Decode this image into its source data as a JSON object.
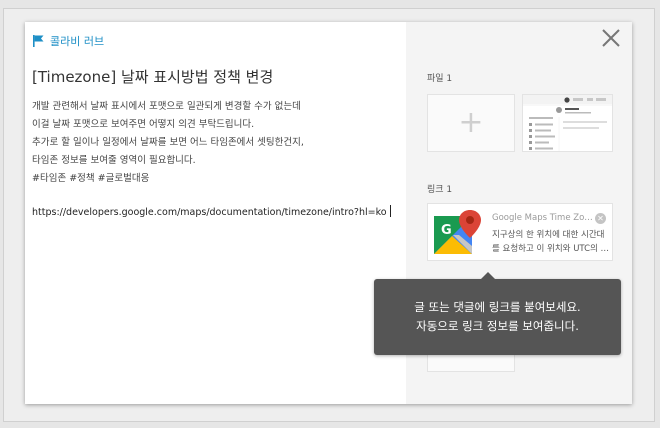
{
  "brand": {
    "label": "콜라비 러브",
    "icon": "flag-icon",
    "color": "#1e8fc6"
  },
  "post": {
    "title": "[Timezone] 날짜 표시방법 정책 변경",
    "lines": [
      "개발 관련해서 날짜 표시에서 포맷으로 일관되게 변경할 수가 없는데",
      "이걸 날짜 포맷으로 보여주면 어떻지 의견 부탁드립니다.",
      "추가로 할 일이나 일정에서 날짜를 보면 어느 타임존에서 셋팅한건지,",
      "타임존 정보를 보여줄 영역이 필요합니다.",
      "#타임존 #정책 #글로벌대응"
    ],
    "url": "https://developers.google.com/maps/documentation/timezone/intro?hl=ko"
  },
  "files": {
    "label": "파일 1",
    "add_icon": "plus-icon"
  },
  "links": {
    "label": "링크 1",
    "card": {
      "title": "Google Maps Time Zone A…",
      "desc_lines": [
        "지구상의 한 위치에 대한 시간대",
        "를 요청하고 이 위치와 UTC의 …"
      ],
      "logo": "google-maps-logo",
      "remove_icon": "close-circle-icon"
    }
  },
  "tooltip": {
    "line1": "글 또는 댓글에 링크를 붙여보세요.",
    "line2": "자동으로 링크 정보를 보여줍니다."
  },
  "close": {
    "icon": "close-icon"
  }
}
